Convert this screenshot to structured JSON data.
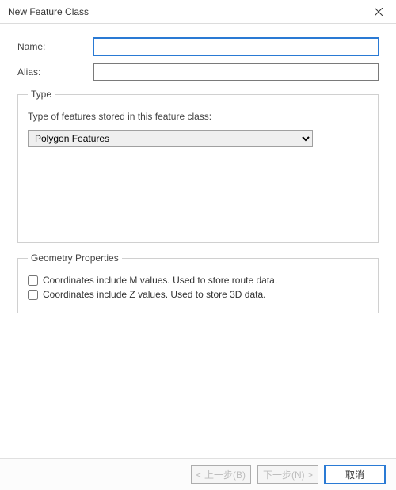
{
  "window": {
    "title": "New Feature Class"
  },
  "form": {
    "name_label": "Name:",
    "name_value": "",
    "alias_label": "Alias:",
    "alias_value": ""
  },
  "type_group": {
    "legend": "Type",
    "description": "Type of features stored in this feature class:",
    "selected": "Polygon Features"
  },
  "geometry_group": {
    "legend": "Geometry Properties",
    "m_label": "Coordinates include M values. Used to store route data.",
    "z_label": "Coordinates include Z values. Used to store 3D data."
  },
  "buttons": {
    "back": "< 上一步(B)",
    "next": "下一步(N) >",
    "cancel": "取消"
  }
}
